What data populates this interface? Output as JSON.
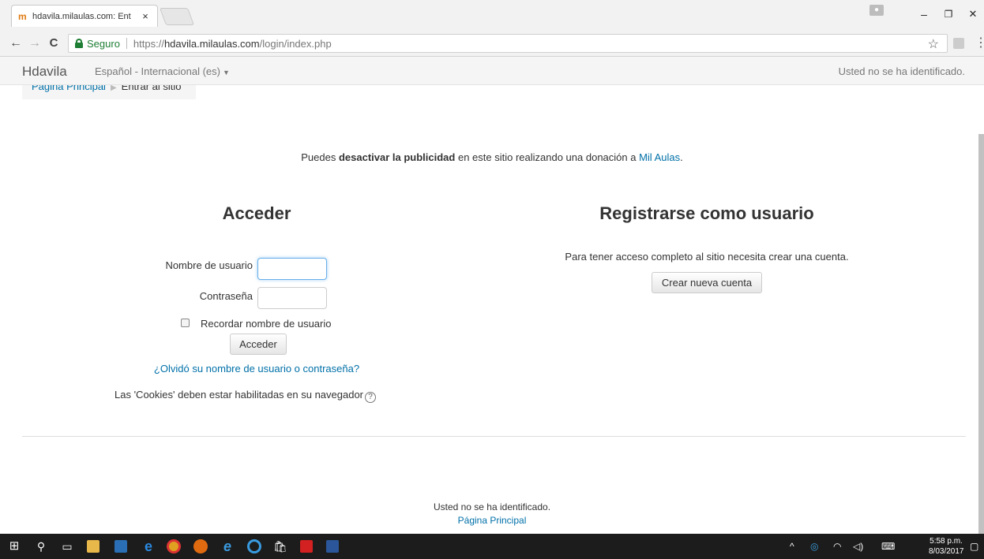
{
  "browser": {
    "tab_title": "hdavila.milaulas.com: Ent",
    "tab_close": "×",
    "secure_label": "Seguro",
    "url_scheme": "https://",
    "url_host": "hdavila.milaulas.com",
    "url_path": "/login/index.php",
    "back": "←",
    "forward": "→",
    "reload": "C",
    "star": "☆",
    "menu": "⋮",
    "minimize": "–",
    "maximize": "❐",
    "close": "✕"
  },
  "navbar": {
    "brand": "Hdavila",
    "language": "Español - Internacional (es)",
    "user_status": "Usted no se ha identificado."
  },
  "breadcrumb": {
    "home": "Página Principal",
    "divider": "▶",
    "current": "Entrar al sitio"
  },
  "notice": {
    "prefix": "Puedes ",
    "bold": "desactivar la publicidad",
    "middle": " en este sitio realizando una donación a ",
    "link": "Mil Aulas",
    "suffix": "."
  },
  "login": {
    "title": "Acceder",
    "username_label": "Nombre de usuario",
    "username_value": "",
    "password_label": "Contraseña",
    "password_value": "",
    "remember_label": "Recordar nombre de usuario",
    "remember_checked": false,
    "submit_label": "Acceder",
    "forgot_link": "¿Olvidó su nombre de usuario o contraseña?",
    "cookies_text": "Las 'Cookies' deben estar habilitadas en su navegador",
    "help_icon": "?"
  },
  "register": {
    "title": "Registrarse como usuario",
    "text": "Para tener acceso completo al sitio necesita crear una cuenta.",
    "button_label": "Crear nueva cuenta"
  },
  "footer": {
    "user_status": "Usted no se ha identificado.",
    "home_link": "Página Principal"
  },
  "taskbar": {
    "time": "5:58 p.m.",
    "date": "8/03/2017"
  }
}
